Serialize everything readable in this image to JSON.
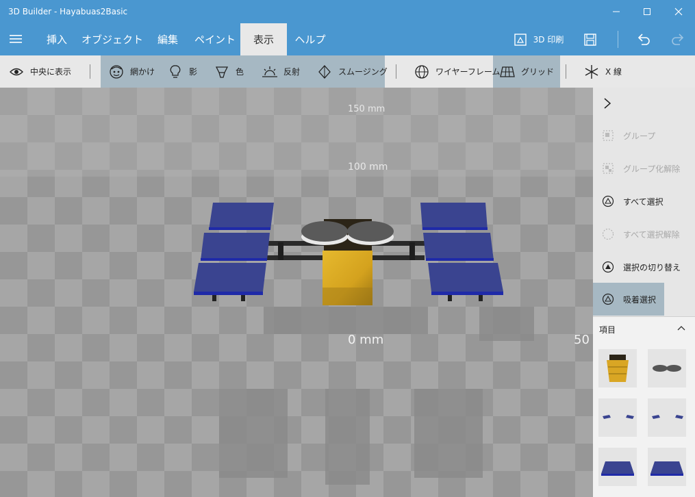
{
  "window": {
    "title": "3D Builder - Hayabuas2Basic"
  },
  "menu": {
    "tabs": [
      {
        "label": "挿入"
      },
      {
        "label": "オブジェクト"
      },
      {
        "label": "編集"
      },
      {
        "label": "ペイント"
      },
      {
        "label": "表示",
        "active": true
      },
      {
        "label": "ヘルプ"
      }
    ],
    "print_label": "3D 印刷"
  },
  "toolbar": {
    "center_view": "中央に表示",
    "shading": "網かけ",
    "shadow": "影",
    "color": "色",
    "reflection": "反射",
    "smoothing": "スムージング",
    "wireframe": "ワイヤーフレーム",
    "grid": "グリッド",
    "xray": "X 線"
  },
  "viewport": {
    "ruler_labels": [
      "150 mm",
      "100 mm",
      "0 mm",
      "50"
    ]
  },
  "sidepanel": {
    "items": [
      {
        "label": "グループ",
        "icon": "group-icon",
        "enabled": false
      },
      {
        "label": "グループ化解除",
        "icon": "ungroup-icon",
        "enabled": false
      },
      {
        "label": "すべて選択",
        "icon": "select-all-icon",
        "enabled": true
      },
      {
        "label": "すべて選択解除",
        "icon": "deselect-all-icon",
        "enabled": false
      },
      {
        "label": "選択の切り替え",
        "icon": "toggle-selection-icon",
        "enabled": true
      },
      {
        "label": "吸着選択",
        "icon": "magnet-select-icon",
        "enabled": true,
        "active": true
      }
    ],
    "items_header": "項目"
  },
  "colors": {
    "accent": "#4a97d0",
    "panel_blue": "#1e2a8a",
    "gold": "#d8a826"
  }
}
